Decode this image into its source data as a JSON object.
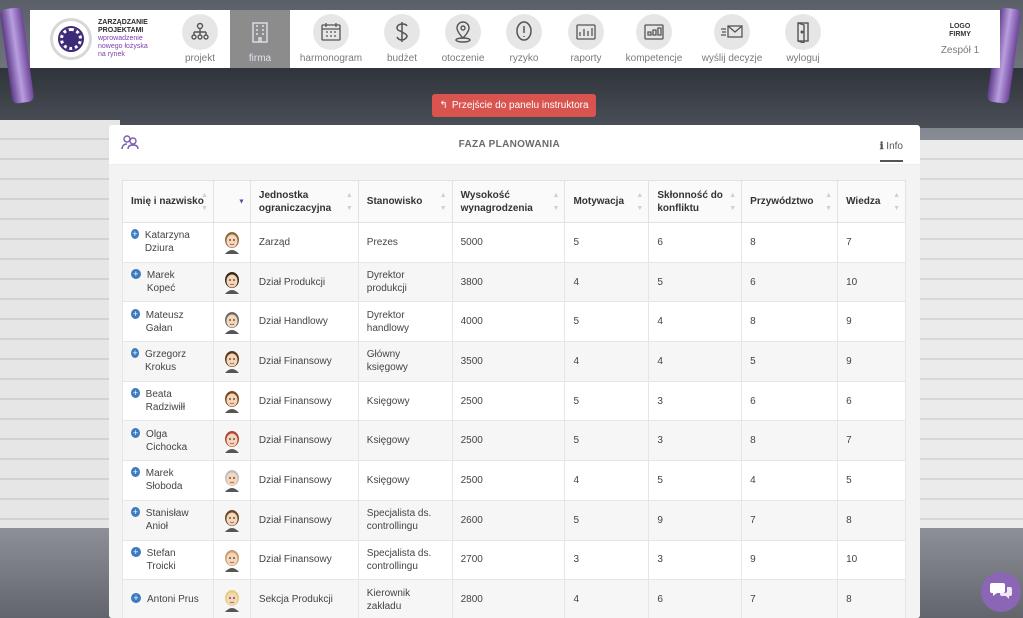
{
  "logo": {
    "line1": "ZARZĄDZANIE",
    "line2": "PROJEKTAMI",
    "line3": "wprowadzenie",
    "line4": "nowego łożyska",
    "line5": "na rynek"
  },
  "nav": [
    {
      "label": "projekt",
      "icon": "org-chart-icon"
    },
    {
      "label": "firma",
      "icon": "building-icon",
      "active": true
    },
    {
      "label": "harmonogram",
      "icon": "calendar-icon"
    },
    {
      "label": "budżet",
      "icon": "dollar-icon"
    },
    {
      "label": "otoczenie",
      "icon": "map-pin-icon"
    },
    {
      "label": "ryzyko",
      "icon": "risk-icon"
    },
    {
      "label": "raporty",
      "icon": "report-icon"
    },
    {
      "label": "kompetencje",
      "icon": "competence-icon"
    },
    {
      "label": "wyślij decyzje",
      "icon": "send-mail-icon"
    },
    {
      "label": "wyloguj",
      "icon": "logout-door-icon"
    }
  ],
  "brand_right": {
    "logo_text": "LOGO FIRMY",
    "team": "Zespół 1"
  },
  "instructor_button": "Przejście do panelu instruktora",
  "panel": {
    "title": "FAZA PLANOWANIA",
    "info": "Info"
  },
  "table": {
    "columns": [
      "Imię i nazwisko",
      "",
      "Jednostka ograniczacyjna",
      "Stanowisko",
      "Wysokość wynagrodzenia",
      "Motywacja",
      "Skłonność do konfliktu",
      "Przywództwo",
      "Wiedza"
    ],
    "rows": [
      {
        "name": "Katarzyna Dziura",
        "unit": "Zarząd",
        "position": "Prezes",
        "salary": "5000",
        "motivation": "5",
        "conflict": "6",
        "leadership": "8",
        "knowledge": "7"
      },
      {
        "name": "Marek Kopeć",
        "unit": "Dział Produkcji",
        "position": "Dyrektor produkcji",
        "salary": "3800",
        "motivation": "4",
        "conflict": "5",
        "leadership": "6",
        "knowledge": "10"
      },
      {
        "name": "Mateusz Gałan",
        "unit": "Dział Handlowy",
        "position": "Dyrektor handlowy",
        "salary": "4000",
        "motivation": "5",
        "conflict": "4",
        "leadership": "8",
        "knowledge": "9"
      },
      {
        "name": "Grzegorz Krokus",
        "unit": "Dział Finansowy",
        "position": "Główny księgowy",
        "salary": "3500",
        "motivation": "4",
        "conflict": "4",
        "leadership": "5",
        "knowledge": "9"
      },
      {
        "name": "Beata Radziwiłł",
        "unit": "Dział Finansowy",
        "position": "Księgowy",
        "salary": "2500",
        "motivation": "5",
        "conflict": "3",
        "leadership": "6",
        "knowledge": "6"
      },
      {
        "name": "Olga Cichocka",
        "unit": "Dział Finansowy",
        "position": "Księgowy",
        "salary": "2500",
        "motivation": "5",
        "conflict": "3",
        "leadership": "8",
        "knowledge": "7"
      },
      {
        "name": "Marek Słoboda",
        "unit": "Dział Finansowy",
        "position": "Księgowy",
        "salary": "2500",
        "motivation": "4",
        "conflict": "5",
        "leadership": "4",
        "knowledge": "5"
      },
      {
        "name": "Stanisław Anioł",
        "unit": "Dział Finansowy",
        "position": "Specjalista ds. controllingu",
        "salary": "2600",
        "motivation": "5",
        "conflict": "9",
        "leadership": "7",
        "knowledge": "8"
      },
      {
        "name": "Stefan Troicki",
        "unit": "Dział Finansowy",
        "position": "Specjalista ds. controllingu",
        "salary": "2700",
        "motivation": "3",
        "conflict": "3",
        "leadership": "9",
        "knowledge": "10"
      },
      {
        "name": "Antoni Prus",
        "unit": "Sekcja Produkcji",
        "position": "Kierownik zakładu",
        "salary": "2800",
        "motivation": "4",
        "conflict": "6",
        "leadership": "7",
        "knowledge": "8"
      }
    ]
  },
  "colors": {
    "accent": "#5b4aa8",
    "danger": "#d9534f",
    "expand": "#3b7bbf"
  }
}
